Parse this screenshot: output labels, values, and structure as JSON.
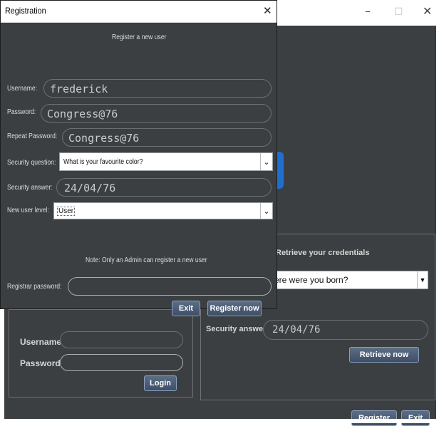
{
  "main_window": {
    "controls": {
      "minimize": "–",
      "maximize": "□",
      "close": "✕"
    },
    "login": {
      "username_label": "Username:",
      "password_label": "Password:",
      "login_button": "Login"
    },
    "retrieve": {
      "title": "Retrieve your credentials",
      "security_question": "ere were you born?",
      "security_answer_label": "Security answer:",
      "security_answer_value": "24/04/76",
      "retrieve_button": "Retrieve now"
    },
    "register_button": "Register",
    "exit_button": "Exit"
  },
  "registration": {
    "title": "Registration",
    "close": "✕",
    "heading": "Register a new user",
    "username_label": "Username:",
    "username_value": "frederick",
    "password_label": "Password:",
    "password_value": "Congress@76",
    "repeat_password_label": "Repeat Password:",
    "repeat_password_value": "Congress@76",
    "security_question_label": "Security question:",
    "security_question_value": "What is your favourite color?",
    "security_answer_label": "Security answer:",
    "security_answer_value": "24/04/76",
    "user_level_label": "New user level:",
    "user_level_value": "User",
    "note": "Note: Only an Admin can register a new user",
    "registrar_password_label": "Registrar password:",
    "exit_button": "Exit",
    "register_button": "Register now"
  },
  "colors": {
    "background": "#3c3f41",
    "accent": "#1f6fd0",
    "button": "#4a5a72"
  },
  "icons": {
    "dropdown": "chevron-down-icon"
  }
}
